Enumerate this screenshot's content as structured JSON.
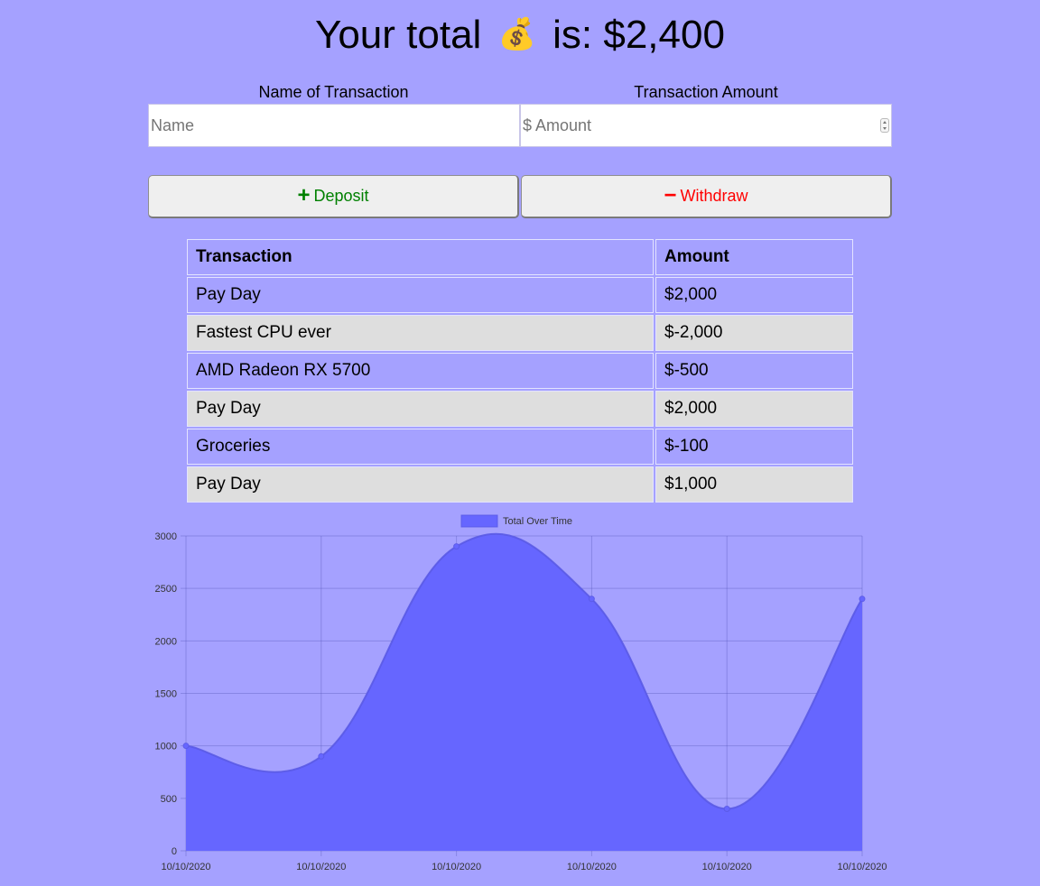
{
  "header": {
    "title_prefix": "Your total",
    "icon": "money-bag-icon",
    "icon_glyph": "💰",
    "title_suffix": "is: $2,400"
  },
  "form": {
    "name_label": "Name of Transaction",
    "name_placeholder": "Name",
    "amount_label": "Transaction Amount",
    "amount_placeholder": "$ Amount"
  },
  "buttons": {
    "deposit_symbol": "+",
    "deposit_label": "Deposit",
    "withdraw_symbol": "−",
    "withdraw_label": "Withdraw"
  },
  "colors": {
    "background": "#a5a1ff",
    "deposit": "#008000",
    "withdraw": "#ff0000",
    "chart_fill": "#6666ff"
  },
  "table": {
    "headers": [
      "Transaction",
      "Amount"
    ],
    "rows": [
      {
        "name": "Pay Day",
        "amount": "$2,000"
      },
      {
        "name": "Fastest CPU ever",
        "amount": "$-2,000"
      },
      {
        "name": "AMD Radeon RX 5700",
        "amount": "$-500"
      },
      {
        "name": "Pay Day",
        "amount": "$2,000"
      },
      {
        "name": "Groceries",
        "amount": "$-100"
      },
      {
        "name": "Pay Day",
        "amount": "$1,000"
      }
    ]
  },
  "chart_data": {
    "type": "area",
    "legend": "Total Over Time",
    "legend_position": "top",
    "grid": true,
    "x": [
      "10/10/2020",
      "10/10/2020",
      "10/10/2020",
      "10/10/2020",
      "10/10/2020",
      "10/10/2020"
    ],
    "series": [
      {
        "name": "Total Over Time",
        "values": [
          1000,
          900,
          2900,
          2400,
          400,
          2400
        ]
      }
    ],
    "yticks": [
      0,
      500,
      1000,
      1500,
      2000,
      2500,
      3000
    ],
    "ylim": [
      0,
      3000
    ]
  }
}
